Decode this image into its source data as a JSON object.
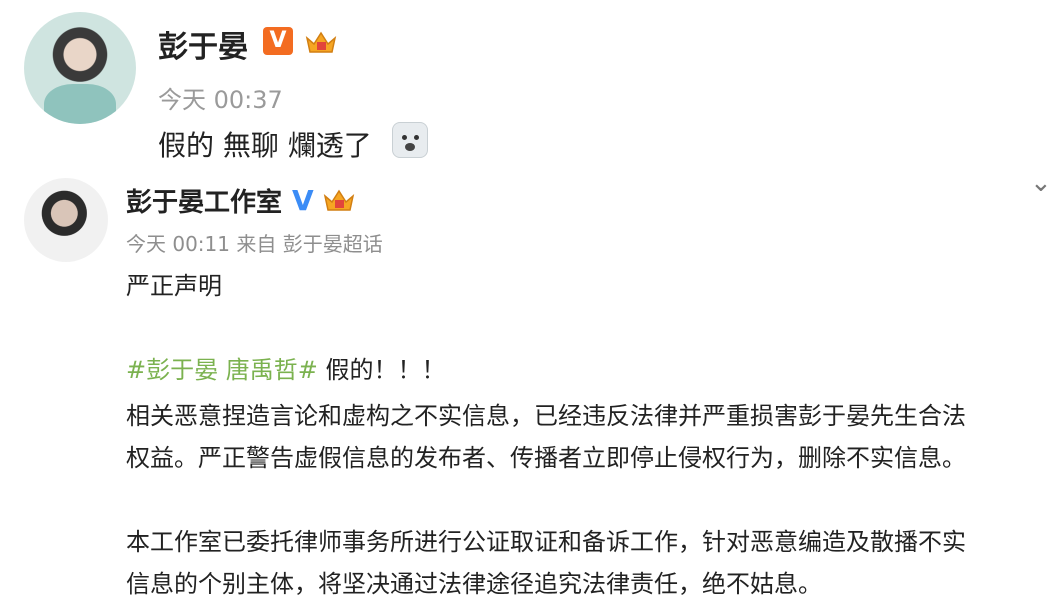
{
  "post1": {
    "author": "彭于晏",
    "time": "今天 00:37",
    "text": "假的 無聊 爛透了"
  },
  "post2": {
    "author": "彭于晏工作室",
    "time": "今天 00:11",
    "source": "来自 彭于晏超话",
    "title": "严正声明",
    "hashtags": "#彭于晏 唐禹哲#",
    "hashtags_after": " 假的！！！",
    "para1_line1": "相关恶意捏造言论和虚构之不实信息，已经违反法律并严重损害彭于晏先生合法",
    "para1_line2": "权益。严正警告虚假信息的发布者、传播者立即停止侵权行为，删除不实信息。",
    "para2_line1": "本工作室已委托律师事务所进行公证取证和备诉工作，针对恶意编造及散播不实",
    "para2_line2": "信息的个别主体，将坚决通过法律途径追究法律责任，绝不姑息。"
  },
  "badges": {
    "verified_orange": "V",
    "verified_blue": "V"
  },
  "icons": {
    "crown": "crown-icon",
    "emoji": "emoji-icon",
    "chevron": "chevron-down-icon"
  },
  "colors": {
    "hashtag": "#7bb24f",
    "verified_orange": "#f36c21",
    "verified_blue": "#3b8cf6"
  }
}
